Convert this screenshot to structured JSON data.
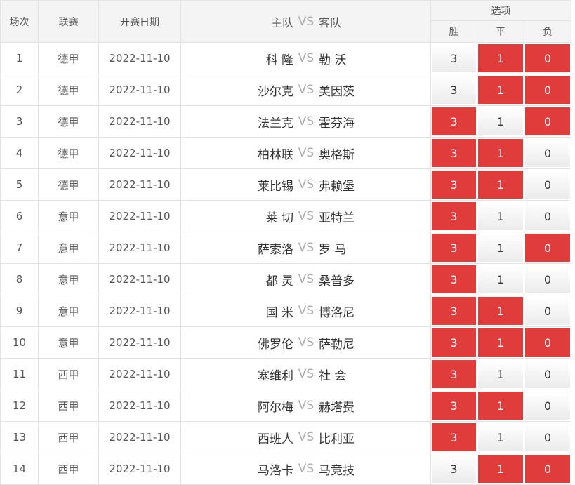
{
  "header": {
    "idx": "场次",
    "league": "联赛",
    "date": "开赛日期",
    "home": "主队",
    "vs": "VS",
    "away": "客队",
    "options": "选项",
    "win": "胜",
    "draw": "平",
    "lose": "负"
  },
  "colors": {
    "selected": "#e03c3c",
    "unselected": "#f2f2f2",
    "border": "#e3e3e3"
  },
  "rows": [
    {
      "idx": "1",
      "league": "德甲",
      "date": "2022-11-10",
      "home": "科 隆",
      "vs": "VS",
      "away": "勒 沃",
      "win": "3",
      "draw": "1",
      "lose": "0",
      "sel": [
        false,
        true,
        true
      ]
    },
    {
      "idx": "2",
      "league": "德甲",
      "date": "2022-11-10",
      "home": "沙尔克",
      "vs": "VS",
      "away": "美因茨",
      "win": "3",
      "draw": "1",
      "lose": "0",
      "sel": [
        false,
        true,
        true
      ]
    },
    {
      "idx": "3",
      "league": "德甲",
      "date": "2022-11-10",
      "home": "法兰克",
      "vs": "VS",
      "away": "霍芬海",
      "win": "3",
      "draw": "1",
      "lose": "0",
      "sel": [
        true,
        false,
        true
      ]
    },
    {
      "idx": "4",
      "league": "德甲",
      "date": "2022-11-10",
      "home": "柏林联",
      "vs": "VS",
      "away": "奥格斯",
      "win": "3",
      "draw": "1",
      "lose": "0",
      "sel": [
        true,
        true,
        false
      ]
    },
    {
      "idx": "5",
      "league": "德甲",
      "date": "2022-11-10",
      "home": "莱比锡",
      "vs": "VS",
      "away": "弗赖堡",
      "win": "3",
      "draw": "1",
      "lose": "0",
      "sel": [
        true,
        true,
        false
      ]
    },
    {
      "idx": "6",
      "league": "意甲",
      "date": "2022-11-10",
      "home": "莱 切",
      "vs": "VS",
      "away": "亚特兰",
      "win": "3",
      "draw": "1",
      "lose": "0",
      "sel": [
        true,
        false,
        false
      ]
    },
    {
      "idx": "7",
      "league": "意甲",
      "date": "2022-11-10",
      "home": "萨索洛",
      "vs": "VS",
      "away": "罗 马",
      "win": "3",
      "draw": "1",
      "lose": "0",
      "sel": [
        true,
        false,
        true
      ]
    },
    {
      "idx": "8",
      "league": "意甲",
      "date": "2022-11-10",
      "home": "都 灵",
      "vs": "VS",
      "away": "桑普多",
      "win": "3",
      "draw": "1",
      "lose": "0",
      "sel": [
        true,
        false,
        false
      ]
    },
    {
      "idx": "9",
      "league": "意甲",
      "date": "2022-11-10",
      "home": "国 米",
      "vs": "VS",
      "away": "博洛尼",
      "win": "3",
      "draw": "1",
      "lose": "0",
      "sel": [
        true,
        true,
        false
      ]
    },
    {
      "idx": "10",
      "league": "意甲",
      "date": "2022-11-10",
      "home": "佛罗伦",
      "vs": "VS",
      "away": "萨勒尼",
      "win": "3",
      "draw": "1",
      "lose": "0",
      "sel": [
        true,
        true,
        true
      ]
    },
    {
      "idx": "11",
      "league": "西甲",
      "date": "2022-11-10",
      "home": "塞维利",
      "vs": "VS",
      "away": "社 会",
      "win": "3",
      "draw": "1",
      "lose": "0",
      "sel": [
        true,
        false,
        false
      ]
    },
    {
      "idx": "12",
      "league": "西甲",
      "date": "2022-11-10",
      "home": "阿尔梅",
      "vs": "VS",
      "away": "赫塔费",
      "win": "3",
      "draw": "1",
      "lose": "0",
      "sel": [
        true,
        true,
        false
      ]
    },
    {
      "idx": "13",
      "league": "西甲",
      "date": "2022-11-10",
      "home": "西班人",
      "vs": "VS",
      "away": "比利亚",
      "win": "3",
      "draw": "1",
      "lose": "0",
      "sel": [
        true,
        false,
        false
      ]
    },
    {
      "idx": "14",
      "league": "西甲",
      "date": "2022-11-10",
      "home": "马洛卡",
      "vs": "VS",
      "away": "马竞技",
      "win": "3",
      "draw": "1",
      "lose": "0",
      "sel": [
        false,
        true,
        true
      ]
    }
  ]
}
